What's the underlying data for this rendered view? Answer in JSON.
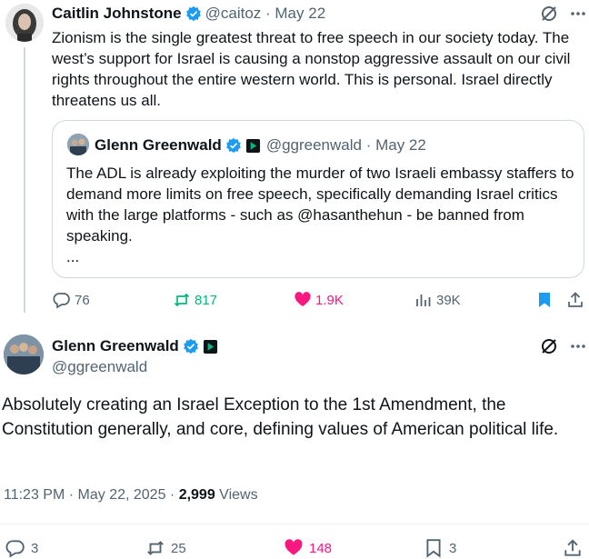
{
  "tweet1": {
    "author_name": "Caitlin Johnstone",
    "handle_date": "@caitoz · May 22",
    "body": "Zionism is the single greatest threat to free speech in our society today. The west’s support for Israel is causing a nonstop aggressive assault on our civil rights throughout the entire western world. This is personal. Israel directly threatens us all.",
    "quote": {
      "author_name": "Glenn Greenwald",
      "handle_date": "@ggreenwald · May 22",
      "body": "The ADL is already exploiting the murder of two Israeli embassy staffers to demand more limits on free speech, specifically demanding Israel critics with the large platforms - such as @hasanthehun - be banned from speaking.",
      "ellipsis": "..."
    },
    "actions": {
      "replies": "76",
      "reposts": "817",
      "likes": "1.9K",
      "views": "39K"
    }
  },
  "tweet2": {
    "author_name": "Glenn Greenwald",
    "handle": "@ggreenwald",
    "body": "Absolutely creating an Israel Exception to the 1st Amendment, the Constitution generally, and core, defining values of American political life.",
    "time": "11:23 PM · May 22, 2025 · ",
    "views_count": "2,999",
    "views_label": " Views",
    "actions": {
      "replies": "3",
      "reposts": "25",
      "likes": "148",
      "bookmarks": "3"
    }
  },
  "colors": {
    "text": "#0f1419",
    "secondary": "#536471",
    "verified": "#1d9bf0",
    "repost": "#00ba7c",
    "like": "#f91880",
    "border": "#cfd9de"
  },
  "icons": [
    "verified-badge-icon",
    "premium-square-icon",
    "grok-icon",
    "more-icon",
    "reply-icon",
    "repost-icon",
    "like-icon",
    "views-icon",
    "bookmark-icon",
    "share-icon"
  ]
}
